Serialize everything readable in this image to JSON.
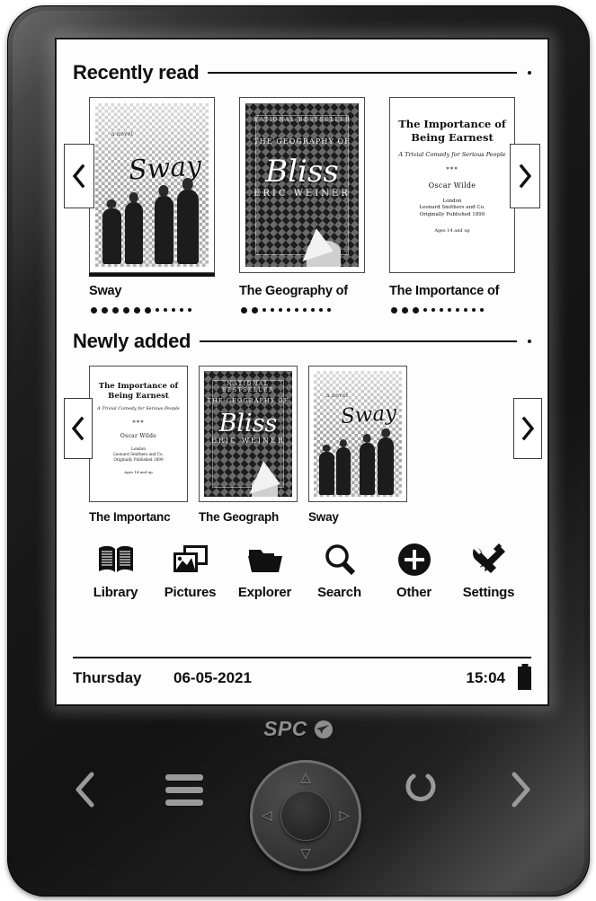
{
  "device": {
    "brand": "SPC",
    "brand_logo_icon": "bird-circle-logo-icon"
  },
  "screen": {
    "sections": [
      {
        "id": "recently-read",
        "title": "Recently read",
        "prev_arrow_icon": "chevron-left-icon",
        "next_arrow_icon": "chevron-right-icon",
        "books": [
          {
            "label": "Sway",
            "selected": true,
            "dots_big": 6,
            "dots_small": 5,
            "cover": {
              "style": "sway",
              "script_title": "Sway",
              "tiny_line": "a novel"
            }
          },
          {
            "label": "The Geography of",
            "selected": false,
            "dots_big": 2,
            "dots_small": 9,
            "cover": {
              "style": "bliss",
              "top_small": "NATIONAL BESTSELLER",
              "top_line": "THE GEOGRAPHY OF",
              "main_title": "Bliss",
              "author": "ERIC WEINER"
            }
          },
          {
            "label": "The Importance of",
            "selected": false,
            "dots_big": 3,
            "dots_small": 8,
            "cover": {
              "style": "earnest",
              "title": "The Importance of Being Earnest",
              "subtitle": "A Trivial Comedy for Serious People",
              "separator": "***",
              "author": "Oscar Wilde",
              "imprint": "London\nLeonard Smithers and Co.\nOriginally Published 1899",
              "footer": "Ages 14 and up"
            }
          }
        ]
      },
      {
        "id": "newly-added",
        "title": "Newly added",
        "prev_arrow_icon": "chevron-left-icon",
        "next_arrow_icon": "chevron-right-icon",
        "books": [
          {
            "label": "The Importanc",
            "selected": false,
            "cover": {
              "style": "earnest",
              "title": "The Importance of Being Earnest",
              "subtitle": "A Trivial Comedy for Serious People",
              "separator": "***",
              "author": "Oscar Wilde",
              "imprint": "London\nLeonard Smithers and Co.\nOriginally Published 1899",
              "footer": "Ages 14 and up"
            }
          },
          {
            "label": "The Geograph",
            "selected": false,
            "cover": {
              "style": "bliss",
              "top_small": "NATIONAL BESTSELLER",
              "top_line": "THE GEOGRAPHY OF",
              "main_title": "Bliss",
              "author": "ERIC WEINER"
            }
          },
          {
            "label": "Sway",
            "selected": false,
            "cover": {
              "style": "sway",
              "script_title": "Sway",
              "tiny_line": "a novel"
            }
          }
        ]
      }
    ],
    "app_menu": [
      {
        "label": "Library",
        "icon": "open-book-icon"
      },
      {
        "label": "Pictures",
        "icon": "photos-icon"
      },
      {
        "label": "Explorer",
        "icon": "folder-icon"
      },
      {
        "label": "Search",
        "icon": "magnifier-icon"
      },
      {
        "label": "Other",
        "icon": "circle-plus-icon"
      },
      {
        "label": "Settings",
        "icon": "wrench-screwdriver-icon"
      }
    ],
    "status_bar": {
      "day": "Thursday",
      "date": "06-05-2021",
      "time": "15:04",
      "battery_icon": "battery-full-icon"
    }
  },
  "hardware": {
    "back_icon": "chevron-left-icon",
    "menu_icon": "hamburger-menu-icon",
    "power_icon": "power-icon",
    "next_icon": "chevron-right-icon",
    "dpad": {
      "up_icon": "chevron-up-icon",
      "down_icon": "chevron-down-icon",
      "left_icon": "chevron-left-icon",
      "right_icon": "chevron-right-icon",
      "center_icon": "ok-button-icon"
    }
  },
  "colors": {
    "screen_background": "#fdfdfd",
    "ink": "#111111",
    "device_body": "#1a1a1a",
    "brand_grey": "#8e8e8e"
  }
}
